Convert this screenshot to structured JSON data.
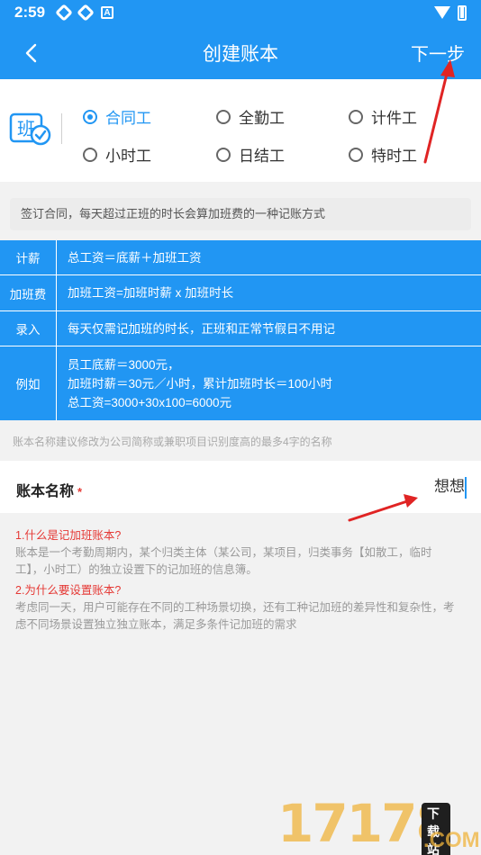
{
  "status_bar": {
    "time": "2:59"
  },
  "app_bar": {
    "title": "创建账本",
    "next_label": "下一步"
  },
  "type_options": [
    {
      "label": "合同工",
      "selected": true
    },
    {
      "label": "全勤工",
      "selected": false
    },
    {
      "label": "计件工",
      "selected": false
    },
    {
      "label": "小时工",
      "selected": false
    },
    {
      "label": "日结工",
      "selected": false
    },
    {
      "label": "特时工",
      "selected": false
    }
  ],
  "logo_char": "班",
  "description": "签订合同，每天超过正班的时长会算加班费的一种记账方式",
  "info_table": [
    {
      "key": "计薪",
      "lines": [
        "总工资＝底薪＋加班工资"
      ]
    },
    {
      "key": "加班费",
      "lines": [
        "加班工资=加班时薪 x 加班时长"
      ]
    },
    {
      "key": "录入",
      "lines": [
        "每天仅需记加班的时长，正班和正常节假日不用记"
      ]
    },
    {
      "key": "例如",
      "lines": [
        "员工底薪＝3000元，",
        "加班时薪＝30元／小时，累计加班时长＝100小时",
        "总工资=3000+30x100=6000元"
      ]
    }
  ],
  "name_hint": "账本名称建议修改为公司简称或兼职项目识别度高的最多4字的名称",
  "name_field": {
    "label": "账本名称",
    "required_mark": "*",
    "value": "想想"
  },
  "faq": {
    "q1": "1.什么是记加班账本?",
    "a1_line1": "账本是一个考勤周期内，某个归类主体（某公司，某项目，归类事务【如散工，临时",
    "a1_line2": "工】，小时工）的独立设置下的记加班的信息簿。",
    "q2": "2.为什么要设置账本?",
    "a2_line1": "考虑同一天，用户可能存在不同的工种场景切换，还有工种记加班的差异性和复杂性，考",
    "a2_line2": "虑不同场景设置独立独立账本，满足多条件记加班的需求"
  },
  "watermark": {
    "number": "17178",
    "tag": "下载站",
    "suffix": ".COM"
  },
  "colors": {
    "primary": "#2196f3",
    "required": "#e53935",
    "annotation_arrow": "#e02424"
  }
}
